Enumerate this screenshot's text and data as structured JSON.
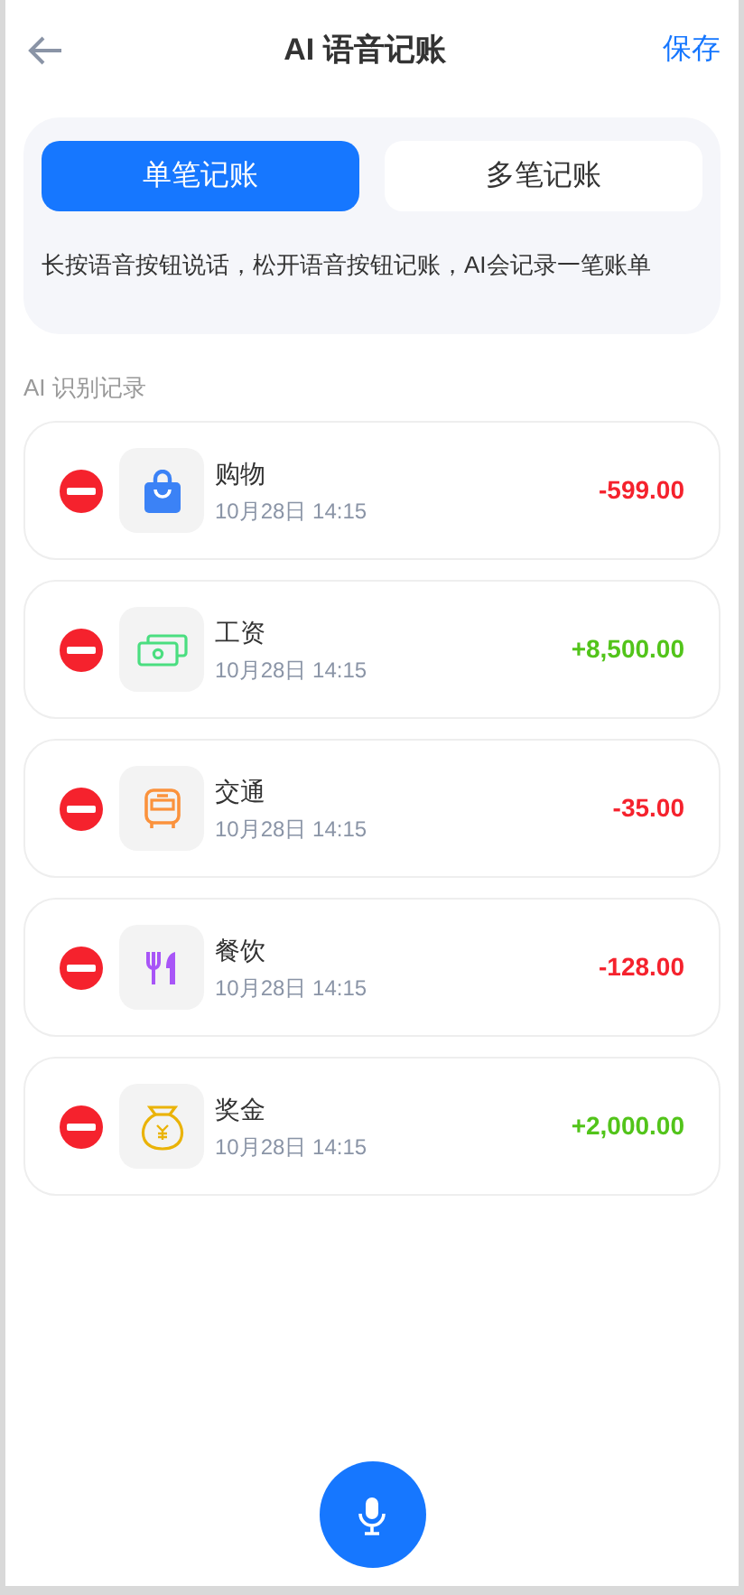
{
  "header": {
    "title": "AI 语音记账",
    "save": "保存"
  },
  "tabs": [
    {
      "label": "单笔记账",
      "selected": true
    },
    {
      "label": "多笔记账",
      "selected": false
    }
  ],
  "hint": "长按语音按钮说话，松开语音按钮记账，AI会记录一笔账单",
  "section_title": "AI 识别记录",
  "records": [
    {
      "kind": "shopping",
      "category": "购物",
      "time": "10月28日 14:15",
      "amount": "-599.00",
      "color": "#f5222d"
    },
    {
      "kind": "salary",
      "category": "工资",
      "time": "10月28日 14:15",
      "amount": "+8,500.00",
      "color": "#52c41a"
    },
    {
      "kind": "transport",
      "category": "交通",
      "time": "10月28日 14:15",
      "amount": "-35.00",
      "color": "#f5222d"
    },
    {
      "kind": "dining",
      "category": "餐饮",
      "time": "10月28日 14:15",
      "amount": "-128.00",
      "color": "#f5222d"
    },
    {
      "kind": "bonus",
      "category": "奖金",
      "time": "10月28日 14:15",
      "amount": "+2,000.00",
      "color": "#52c41a"
    }
  ]
}
